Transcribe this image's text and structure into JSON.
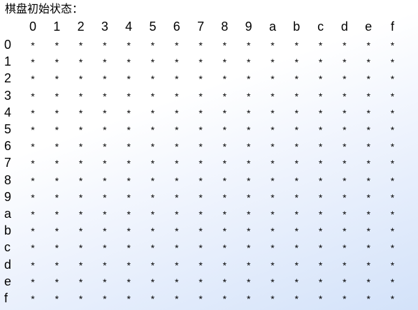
{
  "title": "棋盘初始状态：",
  "columns": [
    "0",
    "1",
    "2",
    "3",
    "4",
    "5",
    "6",
    "7",
    "8",
    "9",
    "a",
    "b",
    "c",
    "d",
    "e",
    "f"
  ],
  "rows": [
    "0",
    "1",
    "2",
    "3",
    "4",
    "5",
    "6",
    "7",
    "8",
    "9",
    "a",
    "b",
    "c",
    "d",
    "e",
    "f"
  ],
  "cell_symbol": "*"
}
